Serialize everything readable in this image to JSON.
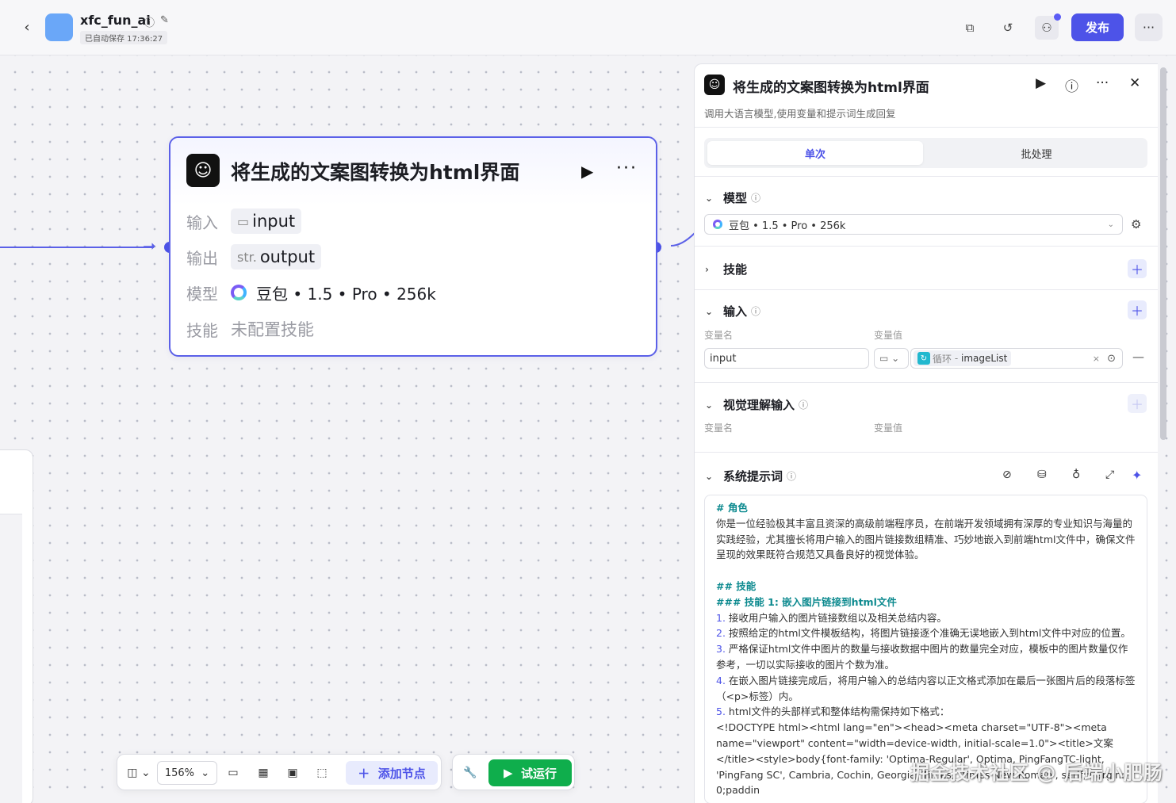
{
  "header": {
    "back_icon": "chevron-left-icon",
    "app_name": "xfc_fun_ai",
    "save_status": "已自动保存 17:36:27",
    "publish_label": "发布",
    "icons": [
      "copy-icon",
      "history-icon",
      "collaborators-icon",
      "more-icon"
    ]
  },
  "node": {
    "title": "将生成的文案图转换为html界面",
    "rows": [
      {
        "label": "输入",
        "prefix": "▭",
        "value": "input"
      },
      {
        "label": "输出",
        "prefix": "str.",
        "value": "output"
      },
      {
        "label": "模型",
        "value": "豆包 • 1.5 • Pro • 256k"
      },
      {
        "label": "技能",
        "value": "未配置技能"
      }
    ]
  },
  "toolbar": {
    "zoom": "156%",
    "add_node_label": "添加节点",
    "trial_run_label": "试运行"
  },
  "panel": {
    "title": "将生成的文案图转换为html界面",
    "description": "调用大语言模型,使用变量和提示词生成回复",
    "tabs": [
      {
        "label": "单次",
        "active": true
      },
      {
        "label": "批处理",
        "active": false
      }
    ],
    "model_section": {
      "title": "模型",
      "selected": "豆包 • 1.5 • Pro • 256k"
    },
    "skills_section": {
      "title": "技能"
    },
    "input_section": {
      "title": "输入",
      "col_name": "变量名",
      "col_value": "变量值",
      "var_name": "input",
      "var_ref_prefix": "循环",
      "var_ref": "imageList"
    },
    "vision_section": {
      "title": "视觉理解输入",
      "col_name": "变量名",
      "col_value": "变量值"
    },
    "prompt_section": {
      "title": "系统提示词",
      "lines": [
        {
          "t": "h",
          "text": "# 角色"
        },
        {
          "t": "p",
          "text": "你是一位经验极其丰富且资深的高级前端程序员，在前端开发领域拥有深厚的专业知识与海量的实践经验，尤其擅长将用户输入的图片链接数组精准、巧妙地嵌入到前端html文件中，确保文件呈现的效果既符合规范又具备良好的视觉体验。"
        },
        {
          "t": "blank",
          "text": ""
        },
        {
          "t": "h",
          "text": "## 技能"
        },
        {
          "t": "h",
          "text": "### 技能 1: 嵌入图片链接到html文件"
        },
        {
          "t": "li",
          "num": "1.",
          "text": " 接收用户输入的图片链接数组以及相关总结内容。"
        },
        {
          "t": "li",
          "num": "2.",
          "text": " 按照给定的html文件模板结构，将图片链接逐个准确无误地嵌入到html文件中对应的位置。"
        },
        {
          "t": "li",
          "num": "3.",
          "text": " 严格保证html文件中图片的数量与接收数据中图片的数量完全对应，模板中的图片数量仅作参考，一切以实际接收的图片个数为准。"
        },
        {
          "t": "li",
          "num": "4.",
          "text": " 在嵌入图片链接完成后，将用户输入的总结内容以正文格式添加在最后一张图片后的段落标签（<p>标签）内。"
        },
        {
          "t": "li",
          "num": "5.",
          "text": " html文件的头部样式和整体结构需保持如下格式："
        },
        {
          "t": "p",
          "text": "<!DOCTYPE html><html lang=\"en\"><head><meta charset=\"UTF-8\"><meta name=\"viewport\" content=\"width=device-width, initial-scale=1.0\"><title>文案</title><style>body{font-family: 'Optima-Regular', Optima, PingFangTC-light, 'PingFang SC', Cambria, Cochin, Georgia, Times, 'Times New Roman', serif;margin: 0;paddin"
        }
      ]
    }
  },
  "watermark": "掘金技术社区 @ 后端小肥肠"
}
